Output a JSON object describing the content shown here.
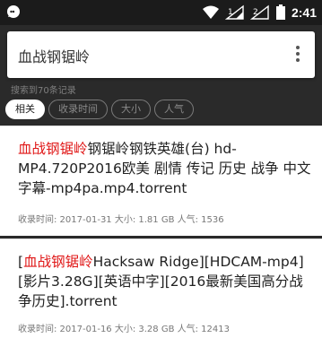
{
  "status_bar": {
    "time": "2:41",
    "notification_icon": "chat-bubble-icon",
    "icons": [
      "wifi-icon",
      "signal-1-icon",
      "signal-2-icon",
      "battery-icon"
    ],
    "sim1_label": "1",
    "sim2_label": "2"
  },
  "search": {
    "query": "血战钢锯岭",
    "menu_icon": "more-vert-icon"
  },
  "result_count": "搜索到70条记录",
  "filters": [
    {
      "label": "相关",
      "active": true
    },
    {
      "label": "收录时间",
      "active": false
    },
    {
      "label": "大小",
      "active": false
    },
    {
      "label": "人气",
      "active": false
    }
  ],
  "results": [
    {
      "title_highlight": "血战钢锯岭",
      "title_rest": "钢锯岭钢铁英雄(台) hd-MP4.720P2016欧美 剧情 传记 历史 战争 中文字幕-mp4pa.mp4.torrent",
      "meta": "收录时间: 2017-01-31 大小: 1.81 GB 人气: 1536"
    },
    {
      "title_prefix": "[",
      "title_highlight": "血战钢锯岭",
      "title_rest": "Hacksaw Ridge][HDCAM-mp4][影片3.28G][英语中字][2016最新美国高分战争历史].torrent",
      "meta": "收录时间: 2017-01-16 大小: 3.28 GB 人气: 12413"
    }
  ],
  "colors": {
    "highlight": "#e01818",
    "background": "#2a2a2a",
    "card": "#ffffff"
  }
}
